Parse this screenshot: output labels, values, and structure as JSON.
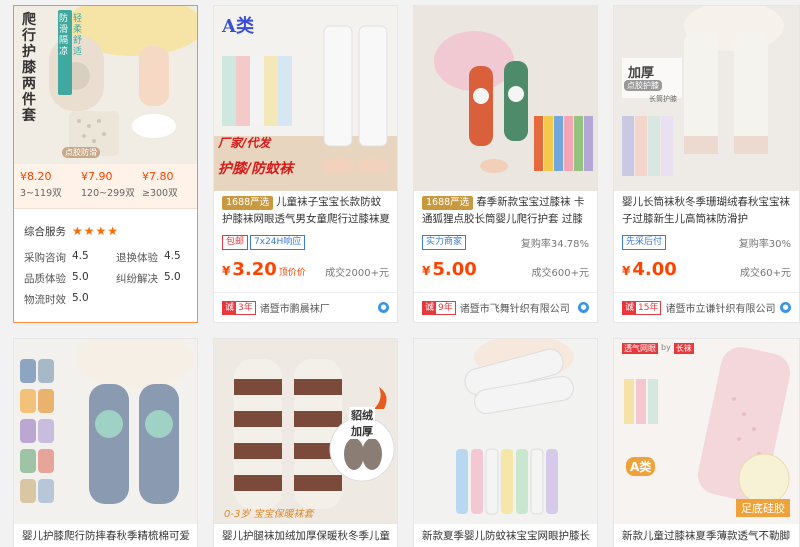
{
  "cards_row1": [
    {
      "id": "c1",
      "image_text": [
        "爬行护膝两件套",
        "防滑隔凉",
        "轻柔舒适",
        "点胶防滑"
      ],
      "price_tiers": [
        {
          "price": "¥8.20",
          "qty": "3~119双"
        },
        {
          "price": "¥7.90",
          "qty": "120~299双"
        },
        {
          "price": "¥7.80",
          "qty": "≥300双"
        }
      ],
      "service_label": "综合服务",
      "stars": "★★★★",
      "metrics": [
        {
          "label": "采购咨询",
          "value": "4.5"
        },
        {
          "label": "退换体验",
          "value": "4.5"
        },
        {
          "label": "品质体验",
          "value": "5.0"
        },
        {
          "label": "纠纷解决",
          "value": "5.0"
        },
        {
          "label": "物流时效",
          "value": "5.0"
        }
      ]
    },
    {
      "id": "c2",
      "image_text": [
        "A类",
        "厂家/代发",
        "护膝/防蚊袜"
      ],
      "tag": "1688严选",
      "title": "儿童袜子宝宝长款防蚊护膝袜网眼透气男女童爬行过膝袜夏天",
      "badges": [
        "包邮",
        "7x24H响应"
      ],
      "repurchase": "",
      "price_cur": "¥",
      "price": "3.20",
      "price_note": "顶价价",
      "deals": "成交2000+元",
      "seller_years": "3年",
      "seller_name": "诸暨市鹏晨袜厂"
    },
    {
      "id": "c3",
      "image_text": [],
      "tag": "1688严选",
      "title": "春季新款宝宝过膝袜 卡通狐狸点胶长筒婴儿爬行护套 过膝婴儿",
      "badges": [
        "实力商家"
      ],
      "repurchase": "复购率34.78%",
      "price_cur": "¥",
      "price": "5.00",
      "price_note": "",
      "deals": "成交600+元",
      "seller_years": "9年",
      "seller_name": "诸暨市飞舞针织有限公司"
    },
    {
      "id": "c4",
      "image_text": [
        "加厚",
        "点胶护膝",
        "长筒护膝"
      ],
      "tag": "",
      "title": "婴儿长筒袜秋冬季珊瑚绒春秋宝宝袜子过膝新生儿高筒袜防滑护",
      "badges": [
        "先采后付"
      ],
      "repurchase": "复购率30%",
      "price_cur": "¥",
      "price": "4.00",
      "price_note": "",
      "deals": "成交60+元",
      "seller_years": "15年",
      "seller_name": "诸暨市立谦针织有限公司"
    }
  ],
  "cards_row2": [
    {
      "id": "c5",
      "image_text": [],
      "title": "婴儿护膝爬行防摔春秋季精梳棉可爱"
    },
    {
      "id": "c6",
      "image_text": [
        "貂绒",
        "加厚",
        "0-3岁 宝宝保暖袜套"
      ],
      "title": "婴儿护腿袜加绒加厚保暖秋冬季儿童"
    },
    {
      "id": "c7",
      "image_text": [],
      "title": "新款夏季婴儿防蚊袜宝宝网眼护膝长"
    },
    {
      "id": "c8",
      "image_text": [
        "透气网眼",
        "by",
        "长袜",
        "A类",
        "足底硅胶"
      ],
      "title": "新款儿童过膝袜夏季薄款透气不勒脚"
    }
  ]
}
